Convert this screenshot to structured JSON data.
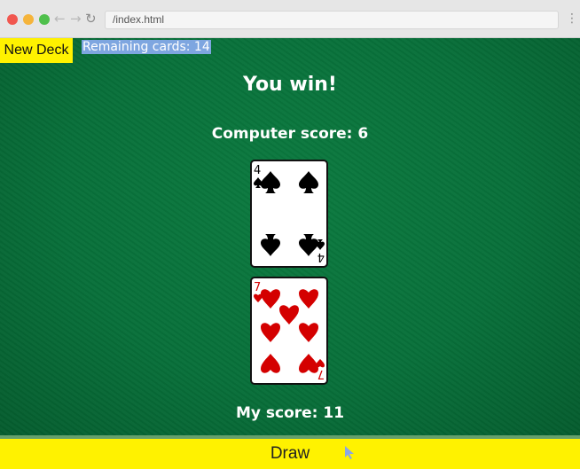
{
  "browser": {
    "url": "/index.html",
    "colors": {
      "close": "#f1574f",
      "minimize": "#f5b43b",
      "maximize": "#4fc04c"
    }
  },
  "game": {
    "new_deck_label": "New Deck",
    "remaining_label": "Remaining cards: 14",
    "result": "You win!",
    "computer_score": "Computer score: 6",
    "my_score": "My score: 11",
    "draw_label": "Draw",
    "cards": [
      {
        "owner": "computer",
        "rank": "4",
        "suit": "spades",
        "color": "#000000"
      },
      {
        "owner": "player",
        "rank": "7",
        "suit": "hearts",
        "color": "#d40000"
      }
    ],
    "colors": {
      "felt": "#08703a",
      "button": "#fff200"
    }
  }
}
